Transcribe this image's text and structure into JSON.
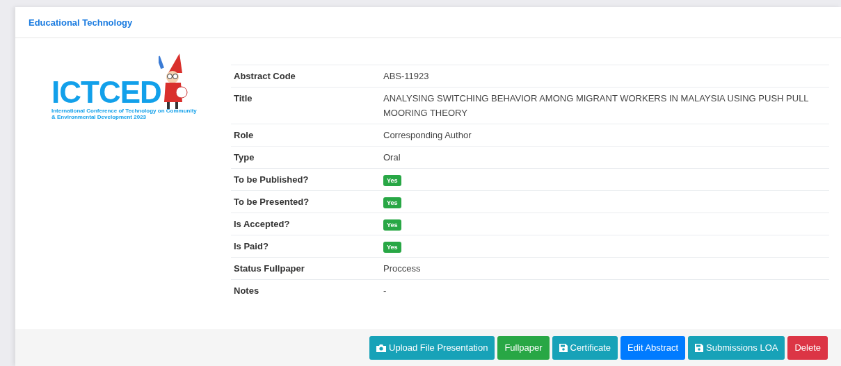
{
  "card": {
    "title": "Educational Technology"
  },
  "logo": {
    "name": "ICTCED",
    "subtitle": "International Conference of Technology on Community & Environmental Development 2023"
  },
  "details": [
    {
      "label": "Abstract Code",
      "kind": "text",
      "value": "ABS-11923"
    },
    {
      "label": "Title",
      "kind": "text",
      "value": "ANALYSING SWITCHING BEHAVIOR AMONG MIGRANT WORKERS IN MALAYSIA USING PUSH PULL MOORING THEORY"
    },
    {
      "label": "Role",
      "kind": "text",
      "value": "Corresponding Author"
    },
    {
      "label": "Type",
      "kind": "text",
      "value": "Oral"
    },
    {
      "label": "To be Published?",
      "kind": "badge",
      "value": "Yes",
      "color": "#28a745"
    },
    {
      "label": "To be Presented?",
      "kind": "badge",
      "value": "Yes",
      "color": "#28a745"
    },
    {
      "label": "Is Accepted?",
      "kind": "badge",
      "value": "Yes",
      "color": "#28a745"
    },
    {
      "label": "Is Paid?",
      "kind": "badge",
      "value": "Yes",
      "color": "#28a745"
    },
    {
      "label": "Status Fullpaper",
      "kind": "text",
      "value": "Proccess"
    },
    {
      "label": "Notes",
      "kind": "text",
      "value": "-"
    }
  ],
  "buttons": [
    {
      "label": "Upload File Presentation",
      "kind": "upload"
    },
    {
      "label": "Fullpaper",
      "kind": "success"
    },
    {
      "label": "Certificate",
      "kind": "save"
    },
    {
      "label": "Edit Abstract",
      "kind": "primary"
    },
    {
      "label": "Submissions LOA",
      "kind": "save"
    },
    {
      "label": "Delete",
      "kind": "danger"
    }
  ]
}
